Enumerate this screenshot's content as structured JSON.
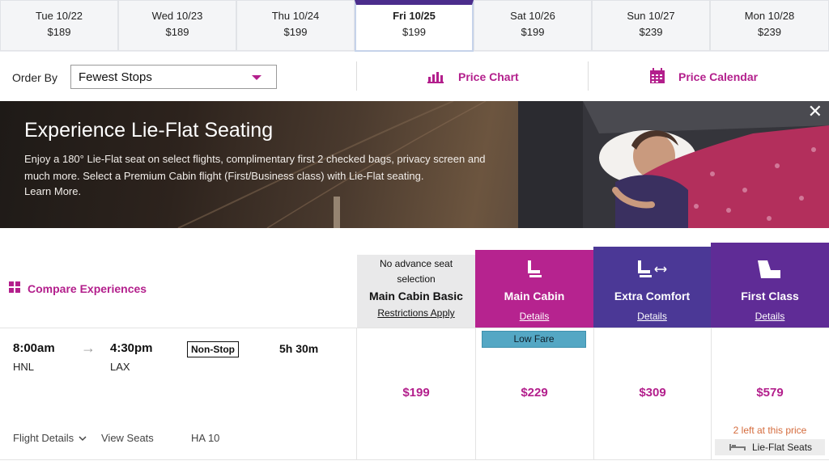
{
  "date_tabs": [
    {
      "day": "Tue 10/22",
      "price": "$189"
    },
    {
      "day": "Wed 10/23",
      "price": "$189"
    },
    {
      "day": "Thu 10/24",
      "price": "$199"
    },
    {
      "day": "Fri 10/25",
      "price": "$199",
      "selected": true
    },
    {
      "day": "Sat 10/26",
      "price": "$199"
    },
    {
      "day": "Sun 10/27",
      "price": "$239"
    },
    {
      "day": "Mon 10/28",
      "price": "$239"
    }
  ],
  "order_by": {
    "label": "Order By",
    "selected": "Fewest Stops",
    "price_chart": "Price Chart",
    "price_calendar": "Price Calendar"
  },
  "banner": {
    "title": "Experience Lie-Flat Seating",
    "text": "Enjoy a 180° Lie-Flat seat on select flights, complimentary first 2 checked bags, privacy screen and much more. Select a Premium Cabin flight (First/Business class) with Lie-Flat seating.",
    "learn_more": "Learn More.",
    "close": "✕"
  },
  "compare_label": "Compare Experiences",
  "cabins": {
    "basic": {
      "note": "No advance seat selection",
      "name": "Main Cabin Basic",
      "link": "Restrictions Apply"
    },
    "main": {
      "name": "Main Cabin",
      "link": "Details"
    },
    "extra": {
      "name": "Extra Comfort",
      "link": "Details"
    },
    "first": {
      "name": "First Class",
      "link": "Details"
    }
  },
  "flight": {
    "depart_time": "8:00am",
    "depart_airport": "HNL",
    "arrive_time": "4:30pm",
    "arrive_airport": "LAX",
    "stops": "Non-Stop",
    "duration": "5h 30m",
    "details_link": "Flight Details",
    "seats_link": "View Seats",
    "flight_number": "HA 10",
    "prices": {
      "basic": "$199",
      "main": "$229",
      "extra": "$309",
      "first": "$579"
    },
    "low_fare_badge": "Low Fare",
    "first_note": "2 left at this price",
    "lie_flat_label": "Lie-Flat Seats"
  },
  "colors": {
    "brand_magenta": "#b31f8c",
    "extra_comfort": "#4b3896",
    "first_class": "#5f2c96",
    "low_fare": "#54a7c4",
    "seats_left": "#d46b3c"
  },
  "icons": [
    "bar-chart-icon",
    "calendar-icon",
    "caret-down-icon",
    "grid-icon",
    "seat-icon",
    "seat-recline-icon",
    "lie-flat-seat-icon",
    "bed-icon",
    "chevron-down-icon",
    "arrow-right-icon",
    "close-icon"
  ]
}
